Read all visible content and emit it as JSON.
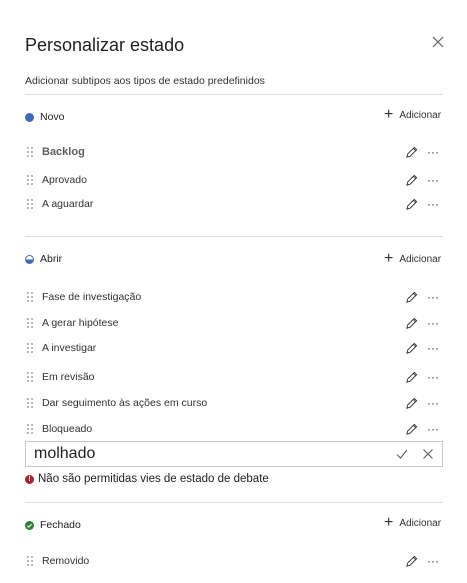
{
  "panel": {
    "title": "Personalizar estado",
    "subtitle": "Adicionar subtipos aos tipos de estado predefinidos",
    "close_icon": "close-icon"
  },
  "colors": {
    "new": "#3b6bb5",
    "open_top": "#ffffff",
    "open_bottom": "#3b6bb5",
    "closed": "#2e7d32",
    "error": "#a4262c"
  },
  "groups": [
    {
      "name": "Novo",
      "add_label": "Adicionar",
      "items": [
        {
          "label": "Backlog"
        },
        {
          "label": "Aprovado"
        },
        {
          "label": "A aguardar"
        }
      ]
    },
    {
      "name": "Abrir",
      "add_label": "Adicionar",
      "items": [
        {
          "label": "Fase de investigação"
        },
        {
          "label": "A gerar hipótese"
        },
        {
          "label": "A investigar"
        },
        {
          "label": "Em revisão"
        },
        {
          "label": "Dar seguimento às ações em curso"
        },
        {
          "label": "Bloqueado"
        }
      ]
    },
    {
      "name": "Fechado",
      "add_label": "Adicionar",
      "items": [
        {
          "label": "Removido"
        }
      ]
    }
  ],
  "edit": {
    "value": "molhado",
    "error": "Não são permitidas vies de estado de debate",
    "error_icon_glyph": "!"
  }
}
